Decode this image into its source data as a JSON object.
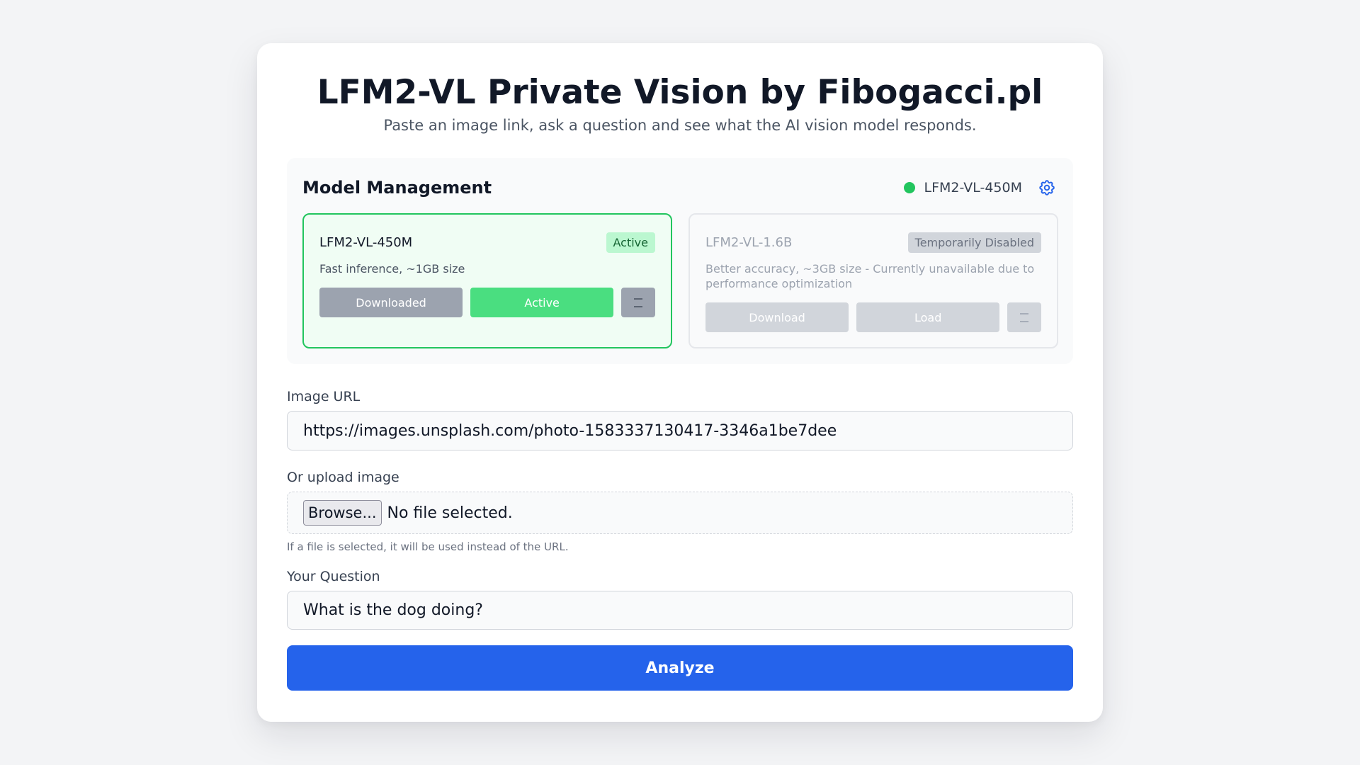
{
  "header": {
    "title": "LFM2-VL Private Vision by Fibogacci.pl",
    "subtitle": "Paste an image link, ask a question and see what the AI vision model responds."
  },
  "model_management": {
    "title": "Model Management",
    "current_model": "LFM2-VL-450M",
    "status_color": "#22c55e",
    "settings_icon": "gear-icon",
    "models": [
      {
        "name": "LFM2-VL-450M",
        "badge": "Active",
        "description": "Fast inference, ~1GB size",
        "download_label": "Downloaded",
        "load_label": "Active",
        "state": "active"
      },
      {
        "name": "LFM2-VL-1.6B",
        "badge": "Temporarily Disabled",
        "description": "Better accuracy, ~3GB size - Currently unavailable due to performance optimization",
        "download_label": "Download",
        "load_label": "Load",
        "state": "disabled"
      }
    ]
  },
  "image_url": {
    "label": "Image URL",
    "value": "https://images.unsplash.com/photo-1583337130417-3346a1be7dee"
  },
  "upload": {
    "label": "Or upload image",
    "browse_label": "Browse...",
    "status": "No file selected.",
    "hint": "If a file is selected, it will be used instead of the URL."
  },
  "question": {
    "label": "Your Question",
    "value": "What is the dog doing?"
  },
  "analyze": {
    "label": "Analyze",
    "color": "#2563eb"
  }
}
